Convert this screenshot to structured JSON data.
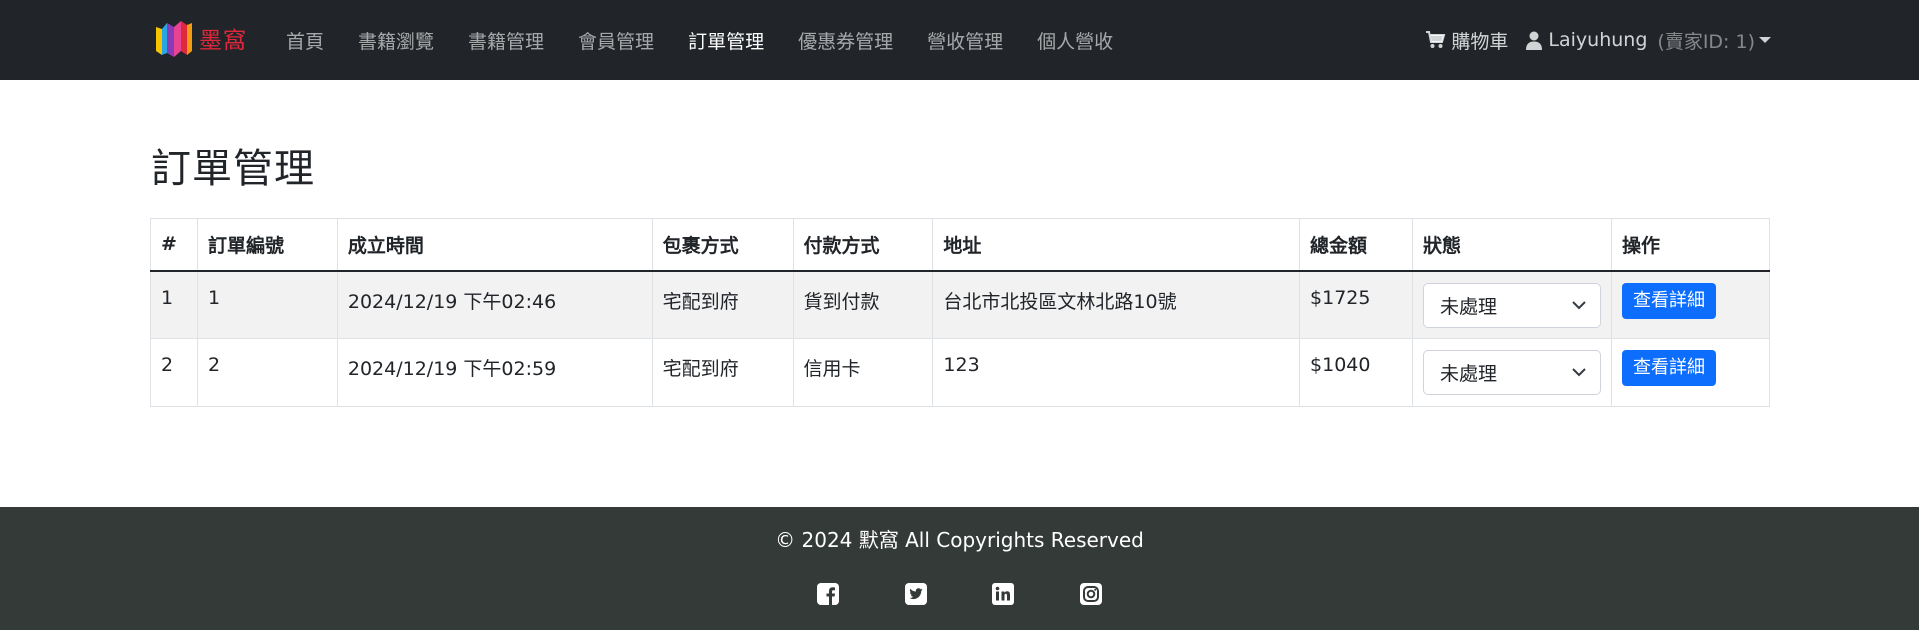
{
  "navbar": {
    "brand": "墨窩",
    "links": [
      {
        "label": "首頁"
      },
      {
        "label": "書籍瀏覽"
      },
      {
        "label": "書籍管理"
      },
      {
        "label": "會員管理"
      },
      {
        "label": "訂單管理",
        "active": true
      },
      {
        "label": "優惠券管理"
      },
      {
        "label": "營收管理"
      },
      {
        "label": "個人營收"
      }
    ],
    "cart_label": "購物車",
    "user_name": "Laiyuhung",
    "user_id_label": "(賣家ID: 1)"
  },
  "main": {
    "title": "訂單管理",
    "table": {
      "headers": [
        "#",
        "訂單編號",
        "成立時間",
        "包裹方式",
        "付款方式",
        "地址",
        "總金額",
        "狀態",
        "操作"
      ],
      "rows": [
        {
          "index": "1",
          "order_no": "1",
          "created": "2024/12/19 下午02:46",
          "shipping": "宅配到府",
          "payment": "貨到付款",
          "address": "台北市北投區文林北路10號",
          "total": "$1725",
          "status": "未處理",
          "action": "查看詳細"
        },
        {
          "index": "2",
          "order_no": "2",
          "created": "2024/12/19 下午02:59",
          "shipping": "宅配到府",
          "payment": "信用卡",
          "address": "123",
          "total": "$1040",
          "status": "未處理",
          "action": "查看詳細"
        }
      ]
    }
  },
  "footer": {
    "copyright": "© 2024 默窩 All Copyrights Reserved",
    "social_icons": [
      "facebook-icon",
      "twitter-icon",
      "linkedin-icon",
      "instagram-icon"
    ]
  },
  "colors": {
    "navbar_bg": "#212529",
    "footer_bg": "#343a37",
    "brand_red": "#e0283c",
    "primary_button": "#0d6efd"
  }
}
